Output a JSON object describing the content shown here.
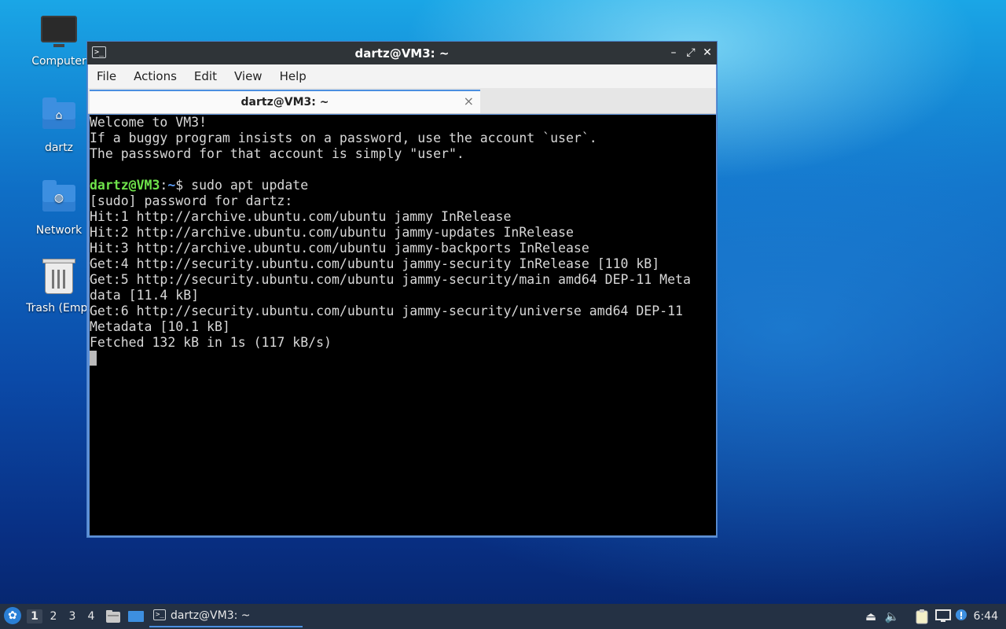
{
  "desktop": {
    "icons": [
      {
        "label": "Computer"
      },
      {
        "label": "dartz"
      },
      {
        "label": "Network"
      },
      {
        "label": "Trash (Empt"
      }
    ]
  },
  "window": {
    "title": "dartz@VM3: ~",
    "controls": {
      "minimize": "–",
      "maximize": "⤢",
      "close": "✕"
    },
    "menu": [
      "File",
      "Actions",
      "Edit",
      "View",
      "Help"
    ],
    "tab": {
      "label": "dartz@VM3: ~",
      "close": "×"
    }
  },
  "terminal": {
    "intro": [
      "Welcome to VM3!",
      "If a buggy program insists on a password, use the account `user`.",
      "The passsword for that account is simply \"user\".",
      ""
    ],
    "prompt": {
      "user_host": "dartz@VM3",
      "sep": ":",
      "path": "~",
      "symbol": "$ ",
      "command": "sudo apt update"
    },
    "output": [
      "[sudo] password for dartz:",
      "Hit:1 http://archive.ubuntu.com/ubuntu jammy InRelease",
      "Hit:2 http://archive.ubuntu.com/ubuntu jammy-updates InRelease",
      "Hit:3 http://archive.ubuntu.com/ubuntu jammy-backports InRelease",
      "Get:4 http://security.ubuntu.com/ubuntu jammy-security InRelease [110 kB]",
      "Get:5 http://security.ubuntu.com/ubuntu jammy-security/main amd64 DEP-11 Meta",
      "data [11.4 kB]",
      "Get:6 http://security.ubuntu.com/ubuntu jammy-security/universe amd64 DEP-11",
      "Metadata [10.1 kB]",
      "Fetched 132 kB in 1s (117 kB/s)"
    ]
  },
  "taskbar": {
    "workspaces": [
      "1",
      "2",
      "3",
      "4"
    ],
    "active_workspace": "1",
    "task_label": "dartz@VM3: ~",
    "clock": "6:44",
    "tray_icons": [
      "eject-icon",
      "volume-icon",
      "clipboard-icon",
      "network-icon",
      "notification-icon"
    ]
  },
  "colors": {
    "accent": "#4b8fe0",
    "prompt_user": "#6fe34b",
    "prompt_path": "#5c9cf5",
    "taskbar": "#243144"
  }
}
